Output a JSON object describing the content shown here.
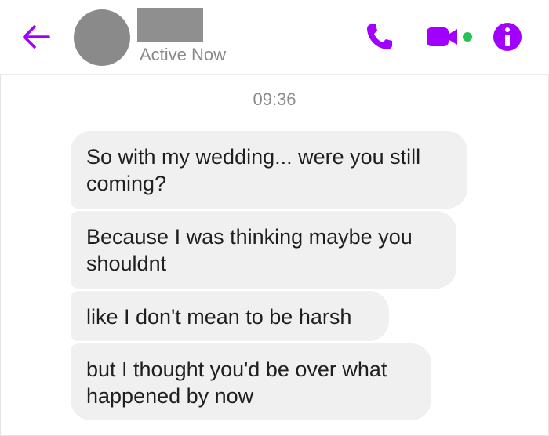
{
  "header": {
    "status": "Active Now",
    "icons": {
      "back": "arrow-left-icon",
      "call": "phone-icon",
      "video": "video-camera-icon",
      "info": "info-icon"
    },
    "accent_color": "#a100ff",
    "online_color": "#25c25a"
  },
  "conversation": {
    "timestamp": "09:36",
    "messages": [
      {
        "text": "So with my wedding... were you still coming?"
      },
      {
        "text": "Because I was thinking maybe you shouldnt"
      },
      {
        "text": "like I don't mean to be harsh"
      },
      {
        "text": "but I thought you'd be over what happened by now"
      }
    ]
  }
}
